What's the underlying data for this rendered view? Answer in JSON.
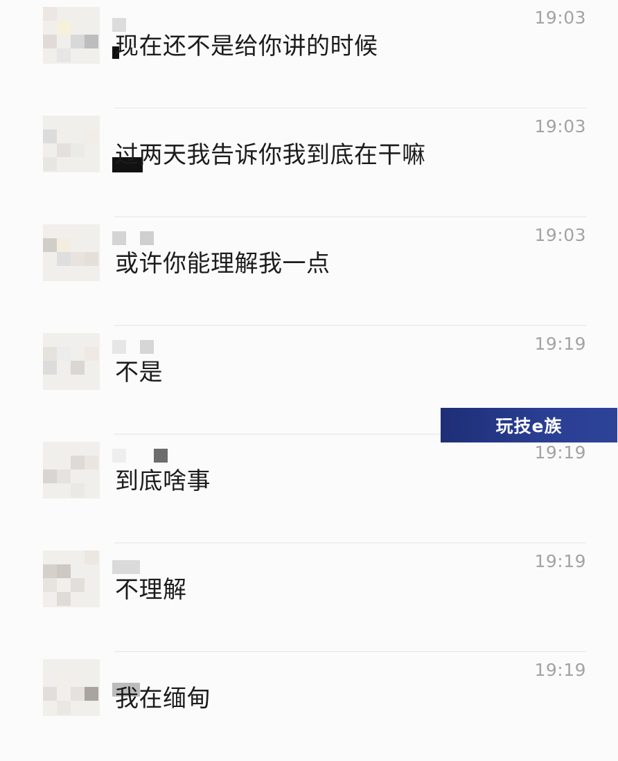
{
  "messages": [
    {
      "time": "19:03",
      "text": "现在还不是给你讲的时候"
    },
    {
      "time": "19:03",
      "text": "过两天我告诉你我到底在干嘛"
    },
    {
      "time": "19:03",
      "text": "或许你能理解我一点"
    },
    {
      "time": "19:19",
      "text": "不是"
    },
    {
      "time": "19:19",
      "text": "到底啥事"
    },
    {
      "time": "19:19",
      "text": "不理解"
    },
    {
      "time": "19:19",
      "text": "我在缅甸"
    }
  ],
  "watermark": {
    "text": "玩技e族",
    "color_from": "#1e2e76",
    "color_to": "#2d4398"
  },
  "colors": {
    "background": "#fbfbfb",
    "text": "#1c1c1c",
    "time": "#a3a3a3",
    "divider": "#efefef"
  }
}
